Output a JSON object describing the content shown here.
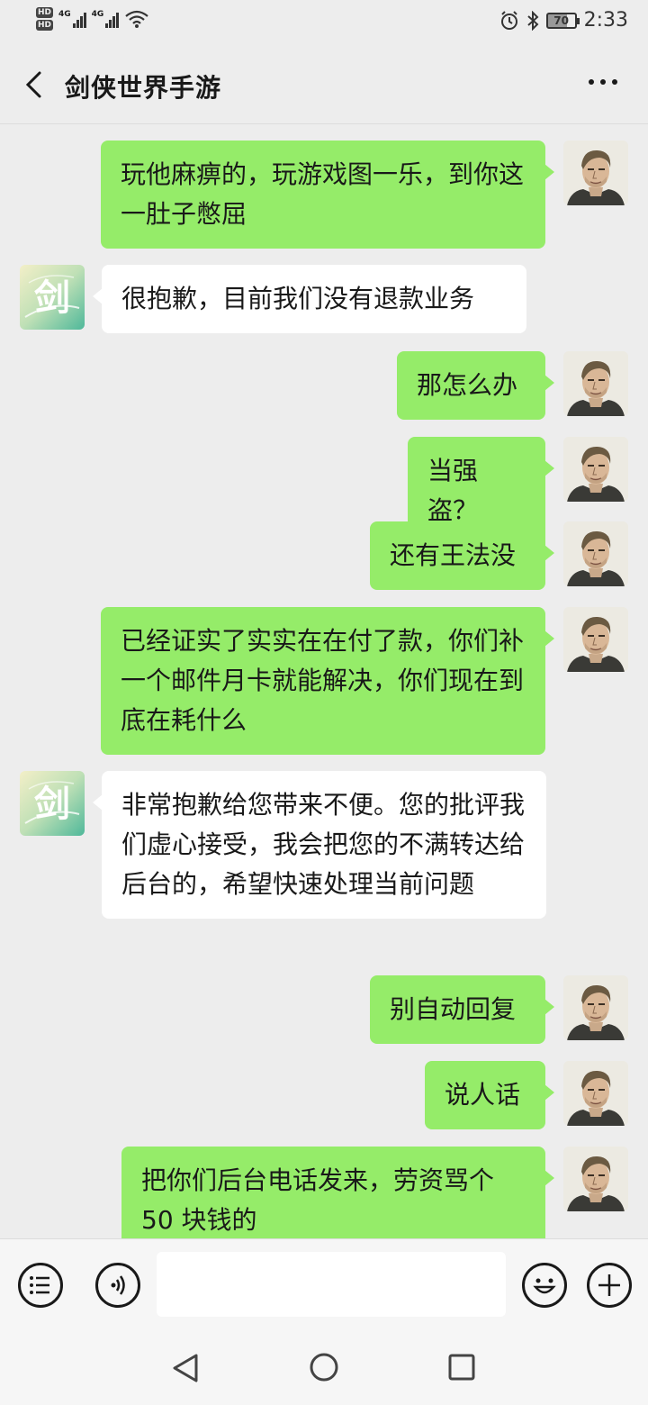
{
  "status_bar": {
    "hd1": "HD",
    "hd2": "HD",
    "net1": "4G",
    "net2": "4G",
    "battery": "70",
    "time": "2:33"
  },
  "header": {
    "title": "剑侠世界手游",
    "back_icon": "chevron-left-icon",
    "more_icon": "more-dots-icon"
  },
  "messages": [
    {
      "sender": "me",
      "text": "玩他麻痹的，玩游戏图一乐，到你这一肚子憋屈"
    },
    {
      "sender": "them",
      "text": "很抱歉，目前我们没有退款业务"
    },
    {
      "sender": "me",
      "text": "那怎么办"
    },
    {
      "sender": "me",
      "text": "当强盗？"
    },
    {
      "sender": "me",
      "text": "还有王法没"
    },
    {
      "sender": "me",
      "text": "已经证实了实实在在付了款，你们补一个邮件月卡就能解决，你们现在到底在耗什么"
    },
    {
      "sender": "them",
      "text": "非常抱歉给您带来不便。您的批评我们虚心接受，我会把您的不满转达给后台的，希望快速处理当前问题"
    },
    {
      "sender": "me",
      "text": "别自动回复"
    },
    {
      "sender": "me",
      "text": "说人话"
    },
    {
      "sender": "me",
      "text": "把你们后台电话发来，劳资骂个50 块钱的"
    }
  ],
  "avatars": {
    "them_glyph": "剑"
  },
  "colors": {
    "my_bubble": "#95ec69",
    "their_bubble": "#ffffff",
    "background": "#ededed"
  },
  "input_bar": {
    "menu_icon": "list-menu-icon",
    "voice_icon": "voice-icon",
    "emoji_icon": "emoji-icon",
    "plus_icon": "plus-icon",
    "value": ""
  },
  "nav_bar": {
    "back_icon": "triangle-back-icon",
    "home_icon": "circle-home-icon",
    "recents_icon": "square-recents-icon"
  }
}
